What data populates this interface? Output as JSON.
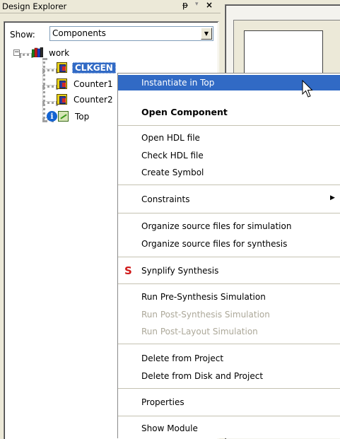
{
  "panel": {
    "title": "Design Explorer",
    "pin_glyph": "ᵽ",
    "dropdown_glyph": "▾",
    "close_glyph": "×"
  },
  "show": {
    "label": "Show:",
    "value": "Components",
    "arrow_glyph": "▼"
  },
  "tree": {
    "expander_glyph": "−",
    "items": [
      {
        "label": "work"
      },
      {
        "label": "CLKGEN"
      },
      {
        "label": "Counter1"
      },
      {
        "label": "Counter2"
      },
      {
        "label": "Top"
      }
    ],
    "info_glyph": "i"
  },
  "context_menu": {
    "items": [
      {
        "label": "Instantiate in Top"
      },
      {
        "label": "Open Component"
      },
      {
        "label": "Open HDL file"
      },
      {
        "label": "Check HDL file"
      },
      {
        "label": "Create Symbol"
      },
      {
        "label": "Constraints"
      },
      {
        "label": "Organize source files for simulation"
      },
      {
        "label": "Organize source files for synthesis"
      },
      {
        "label": "Synplify Synthesis"
      },
      {
        "label": "Run Pre-Synthesis Simulation"
      },
      {
        "label": "Run Post-Synthesis Simulation"
      },
      {
        "label": "Run Post-Layout Simulation"
      },
      {
        "label": "Delete from Project"
      },
      {
        "label": "Delete from Disk and Project"
      },
      {
        "label": "Properties"
      },
      {
        "label": "Show Module"
      }
    ],
    "submenu_arrow": "▶",
    "synplify_glyph": "S"
  },
  "colors": {
    "highlight": "#316ac5",
    "window_bg": "#ece9d8",
    "disabled_text": "#aca899"
  }
}
